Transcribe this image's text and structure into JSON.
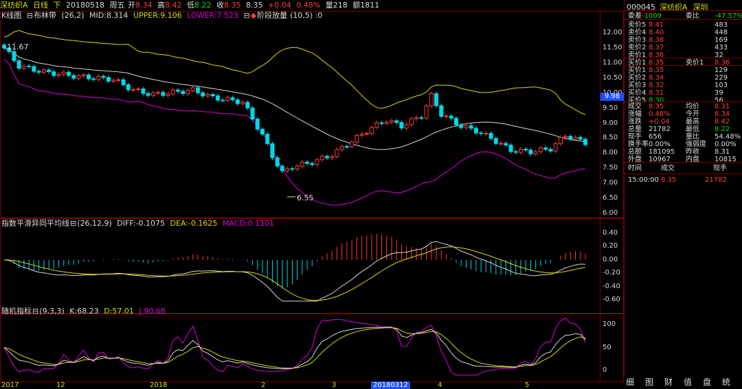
{
  "header": {
    "name": "深纺织A",
    "period": "日线",
    "adjust": "下",
    "date": "20180518",
    "weekday": "周五",
    "open_label": "开",
    "open": "8.34",
    "high_label": "高",
    "high": "8.42",
    "low_label": "低",
    "low": "8.22",
    "close_label": "收",
    "close": "8.35",
    "last": "8.35",
    "change": "+0.04",
    "change_pct": "0.48%",
    "volume_label": "量",
    "volume": "218",
    "amount_label": "额",
    "amount": "1811"
  },
  "kline": {
    "title": "K线图",
    "indicator": "布林带",
    "params": "(26,2)",
    "mid_label": "MID:",
    "mid": "8.314",
    "upper_label": "UPPER:",
    "upper": "9.106",
    "lower_label": "LOWER:",
    "lower": "7.523",
    "extra_icon": "◆",
    "extra_label": "阶段放量",
    "extra_params": "(10,5) :0",
    "high_marker": "11.67",
    "low_marker": "6.55",
    "current_price_tag": "9.98",
    "y_ticks": [
      "12.00",
      "11.50",
      "11.00",
      "10.50",
      "10.00",
      "9.50",
      "9.00",
      "8.50",
      "8.00",
      "7.50",
      "7.00",
      "6.50",
      "6.00"
    ],
    "ylim": [
      6.0,
      12.0
    ]
  },
  "macd": {
    "title": "指数平滑异同平均线",
    "params": "(26,12,9)",
    "diff_label": "DIFF:",
    "diff": "-0.1075",
    "dea_label": "DEA:",
    "dea": "-0.1625",
    "macd_label": "MACD:",
    "macd": "0.1101",
    "y_ticks": [
      "0.40",
      "0.20",
      "0.00",
      "-0.20",
      "-0.40",
      "-0.60"
    ],
    "ylim": [
      -0.6,
      0.4
    ]
  },
  "kdj": {
    "title": "随机指标",
    "params": "(9,3,3)",
    "k_label": "K:",
    "k": "68.23",
    "d_label": "D:",
    "d": "57.01",
    "j_label": "J:",
    "j": "90.68",
    "y_ticks": [
      "100",
      "50",
      "0"
    ],
    "ylim": [
      0,
      100
    ]
  },
  "x_axis": {
    "labels": [
      "2017",
      "12",
      "2018",
      "2",
      "3",
      "20180312",
      "4",
      "5"
    ],
    "highlight": "20180312"
  },
  "quote": {
    "code": "000045",
    "name": "深纺织A",
    "market": "深圳",
    "weibi_label": "委差",
    "weibi_diff": "-1009",
    "wb_label": "委比",
    "wb": "-47.57%",
    "asks": [
      {
        "label": "卖价5",
        "price": "8.41",
        "vol": "483"
      },
      {
        "label": "卖价4",
        "price": "8.40",
        "vol": "448"
      },
      {
        "label": "卖价3",
        "price": "8.38",
        "vol": "169"
      },
      {
        "label": "卖价2",
        "price": "8.37",
        "vol": "433"
      },
      {
        "label": "卖价1",
        "price": "8.36",
        "vol": "32"
      }
    ],
    "buy1_label": "买价1",
    "buy1": "8.35",
    "sell1_label": "卖价1",
    "sell1": "8.36",
    "bids": [
      {
        "label": "买价1",
        "price": "8.35",
        "vol": "129"
      },
      {
        "label": "买价2",
        "price": "8.34",
        "vol": "229"
      },
      {
        "label": "买价3",
        "price": "8.32",
        "vol": "103"
      },
      {
        "label": "买价4",
        "price": "8.31",
        "vol": "39"
      },
      {
        "label": "买价5",
        "price": "8.30",
        "vol": "56"
      }
    ],
    "stats": [
      [
        "成交",
        "8.35",
        "均价",
        "8.31"
      ],
      [
        "涨幅",
        "0.48%",
        "今开",
        "8.34"
      ],
      [
        "涨跌",
        "+0.04",
        "最高",
        "8.42"
      ],
      [
        "总量",
        "21782",
        "最低",
        "8.22"
      ],
      [
        "现手",
        "656",
        "量比",
        "54.48%"
      ],
      [
        "换手率",
        "0.00%",
        "强弱度",
        "0.00%"
      ],
      [
        "总额",
        "181095",
        "昨收",
        "8.31"
      ],
      [
        "外盘",
        "10967",
        "内盘",
        "10815"
      ]
    ],
    "trades_header": [
      "时间",
      "成交",
      "现手"
    ],
    "trades": [
      [
        "15:00:00",
        "8.35",
        "21782"
      ]
    ]
  },
  "tabs": [
    "细",
    "图",
    "财",
    "值",
    "盘",
    "统"
  ],
  "colors": {
    "up": "#ff3b3b",
    "down": "#00d7e6",
    "yellow": "#dddd00",
    "magenta": "#e000e0",
    "white_line": "#d8d8d8",
    "grid": "#7a0000"
  },
  "chart_data": {
    "type": "line",
    "series": [
      {
        "name": "DIFF",
        "values": []
      },
      {
        "name": "DEA",
        "values": []
      },
      {
        "name": "K",
        "values": []
      },
      {
        "name": "D",
        "values": []
      },
      {
        "name": "J",
        "values": []
      }
    ]
  }
}
